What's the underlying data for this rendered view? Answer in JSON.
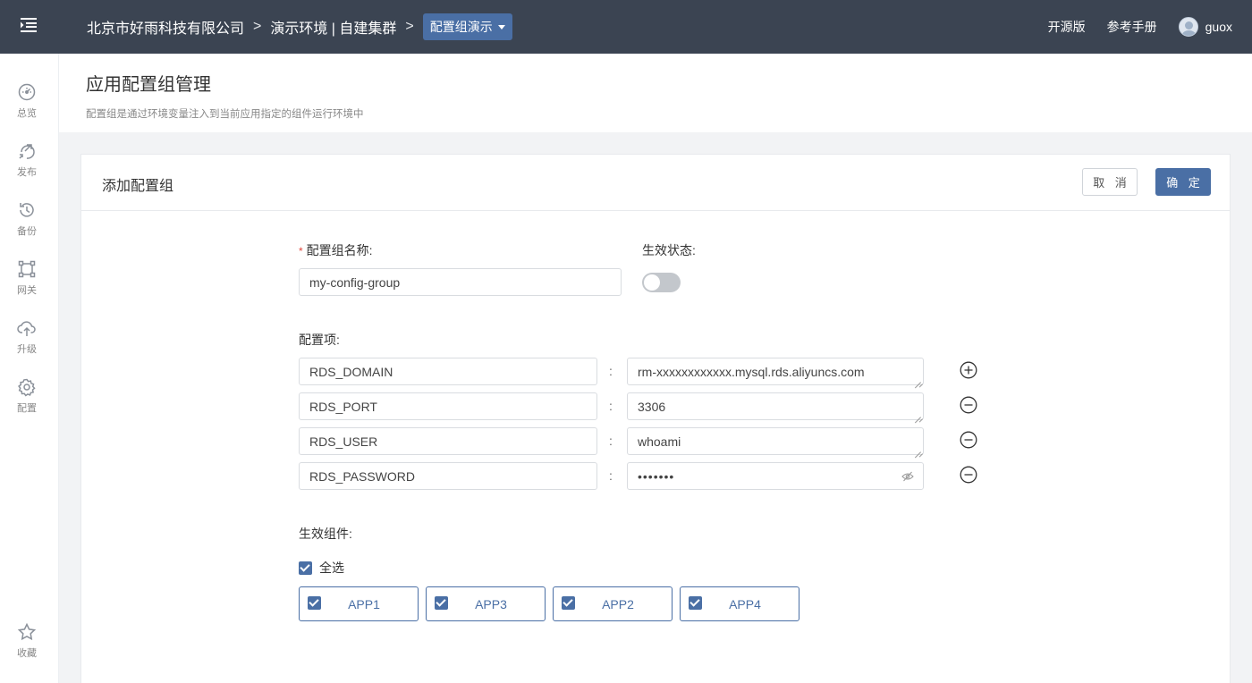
{
  "topbar": {
    "breadcrumb": [
      "北京市好雨科技有限公司",
      "演示环境 | 自建集群"
    ],
    "separator": ">",
    "current_dropdown": "配置组演示",
    "links": [
      "开源版",
      "参考手册"
    ],
    "username": "guox"
  },
  "sidebar": {
    "items": [
      {
        "label": "总览",
        "icon": "dashboard-icon"
      },
      {
        "label": "发布",
        "icon": "publish-icon"
      },
      {
        "label": "备份",
        "icon": "backup-icon"
      },
      {
        "label": "网关",
        "icon": "gateway-icon"
      },
      {
        "label": "升级",
        "icon": "upgrade-icon"
      },
      {
        "label": "配置",
        "icon": "settings-icon"
      }
    ],
    "bottom_item": {
      "label": "收藏",
      "icon": "star-icon"
    }
  },
  "page": {
    "title": "应用配置组管理",
    "description": "配置组是通过环境变量注入到当前应用指定的组件运行环境中"
  },
  "card": {
    "title": "添加配置组",
    "cancel_label": "取 消",
    "ok_label": "确 定"
  },
  "form": {
    "name_label": "配置组名称:",
    "required_mark": "*",
    "name_value": "my-config-group",
    "status_label": "生效状态:",
    "status_on": false,
    "items_label": "配置项:",
    "separator": ":",
    "items": [
      {
        "key": "RDS_DOMAIN",
        "value": "rm-xxxxxxxxxxxx.mysql.rds.aliyuncs.com",
        "action": "add"
      },
      {
        "key": "RDS_PORT",
        "value": "3306",
        "action": "remove"
      },
      {
        "key": "RDS_USER",
        "value": "whoami",
        "action": "remove"
      },
      {
        "key": "RDS_PASSWORD",
        "value": "•••••••",
        "action": "remove",
        "masked": true
      }
    ],
    "components_label": "生效组件:",
    "select_all_label": "全选",
    "apps": [
      "APP1",
      "APP3",
      "APP2",
      "APP4"
    ]
  },
  "colors": {
    "topbar": "#3b4452",
    "primary": "#4a6fa5",
    "required": "#e0463c"
  }
}
